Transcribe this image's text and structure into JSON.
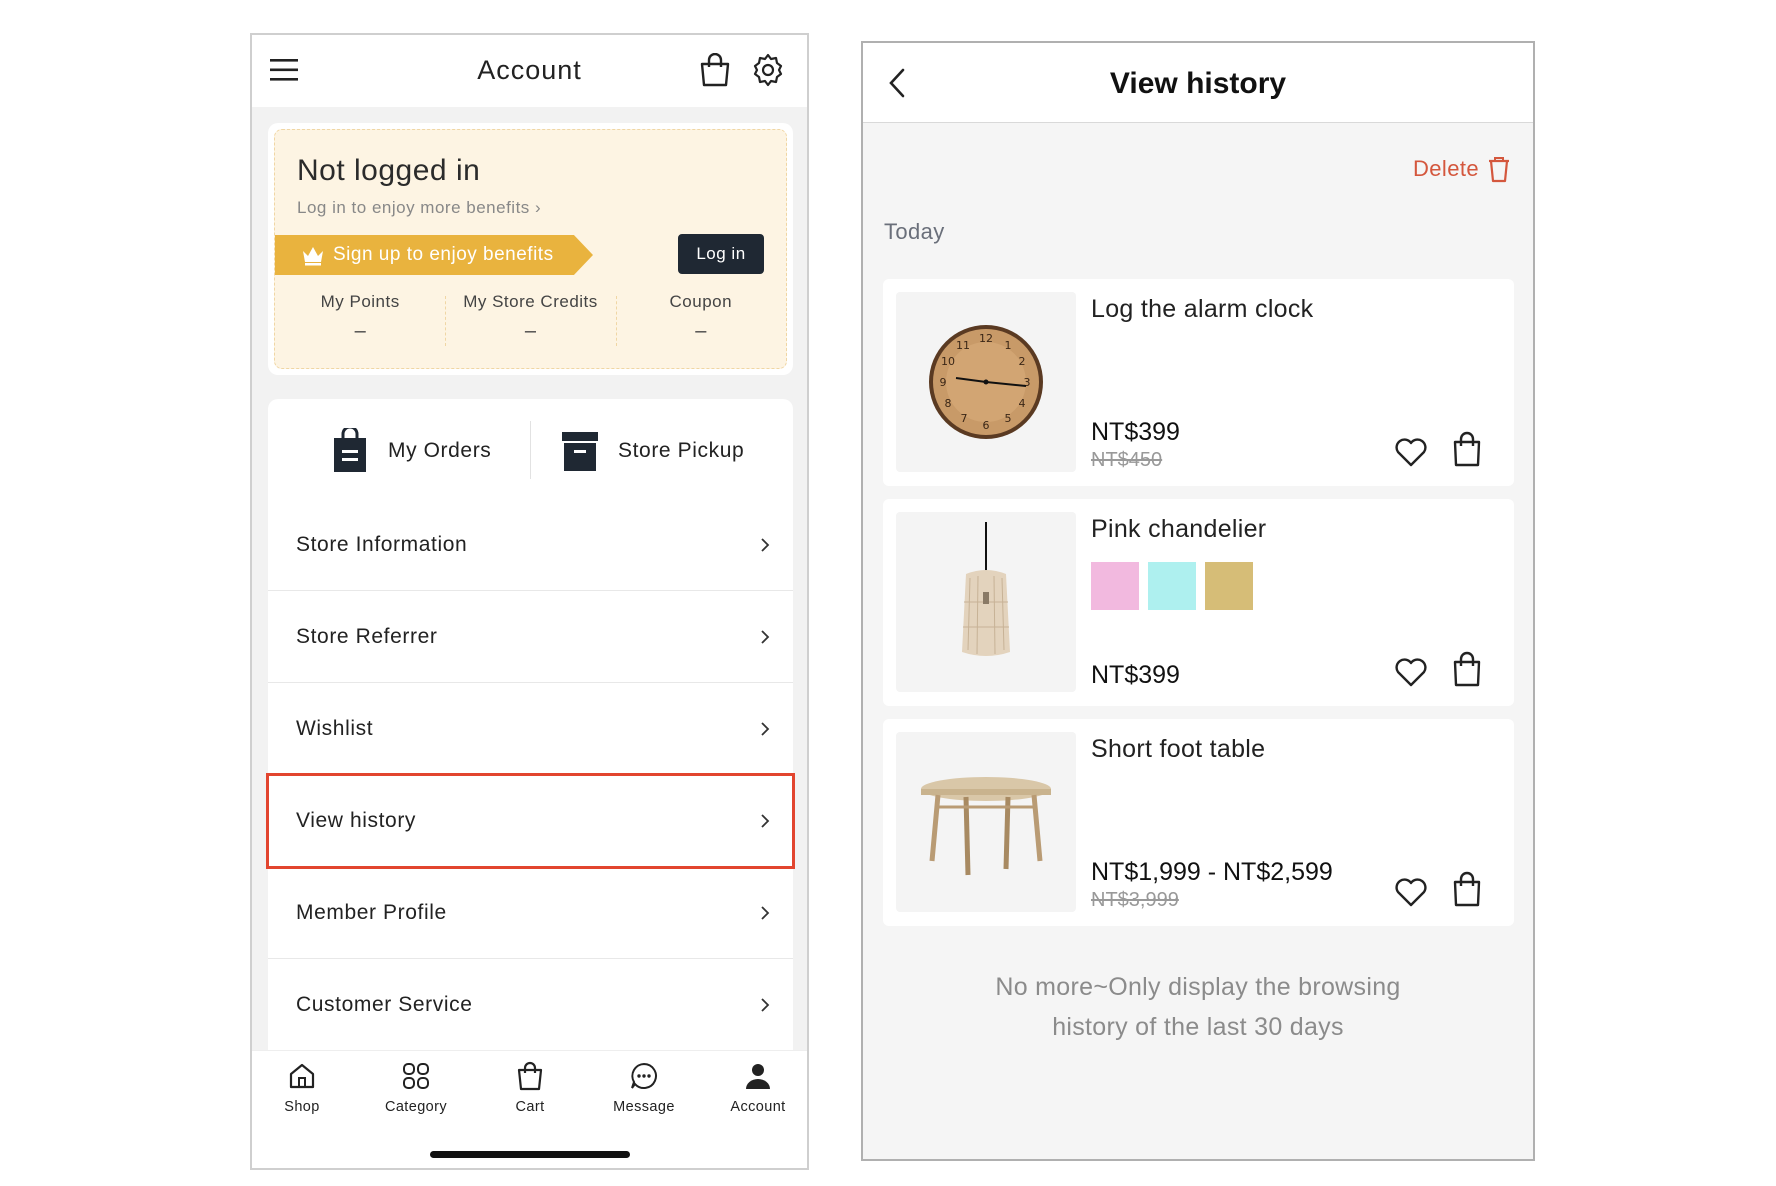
{
  "left": {
    "header": {
      "title": "Account"
    },
    "login_card": {
      "title": "Not logged in",
      "subtitle": "Log in to enjoy more benefits",
      "subtitle_arrow": "›",
      "signup_banner": "Sign up to enjoy benefits",
      "login_button": "Log in",
      "stats": [
        {
          "label": "My Points",
          "value": "–"
        },
        {
          "label": "My Store Credits",
          "value": "–"
        },
        {
          "label": "Coupon",
          "value": "–"
        }
      ]
    },
    "orders": {
      "my_orders": "My Orders",
      "store_pickup": "Store Pickup"
    },
    "menu": [
      "Store Information",
      "Store Referrer",
      "Wishlist",
      "View history",
      "Member Profile",
      "Customer Service"
    ],
    "highlighted_menu_item": "View history",
    "highlight_color": "#e2452f",
    "bottom_nav": [
      "Shop",
      "Category",
      "Cart",
      "Message",
      "Account"
    ]
  },
  "right": {
    "header": {
      "title": "View history"
    },
    "delete_label": "Delete",
    "delete_color": "#d4573d",
    "section_label": "Today",
    "products": [
      {
        "name": "Log the alarm clock",
        "price": "NT$399",
        "original_price": "NT$450"
      },
      {
        "name": "Pink chandelier",
        "price": "NT$399",
        "swatches": [
          "#f2b9df",
          "#aef0ef",
          "#d6bd77"
        ]
      },
      {
        "name": "Short foot table",
        "price": "NT$1,999 - NT$2,599",
        "original_price": "NT$3,999"
      }
    ],
    "footer_note": "No more~Only display the browsing history of the last 30 days"
  }
}
